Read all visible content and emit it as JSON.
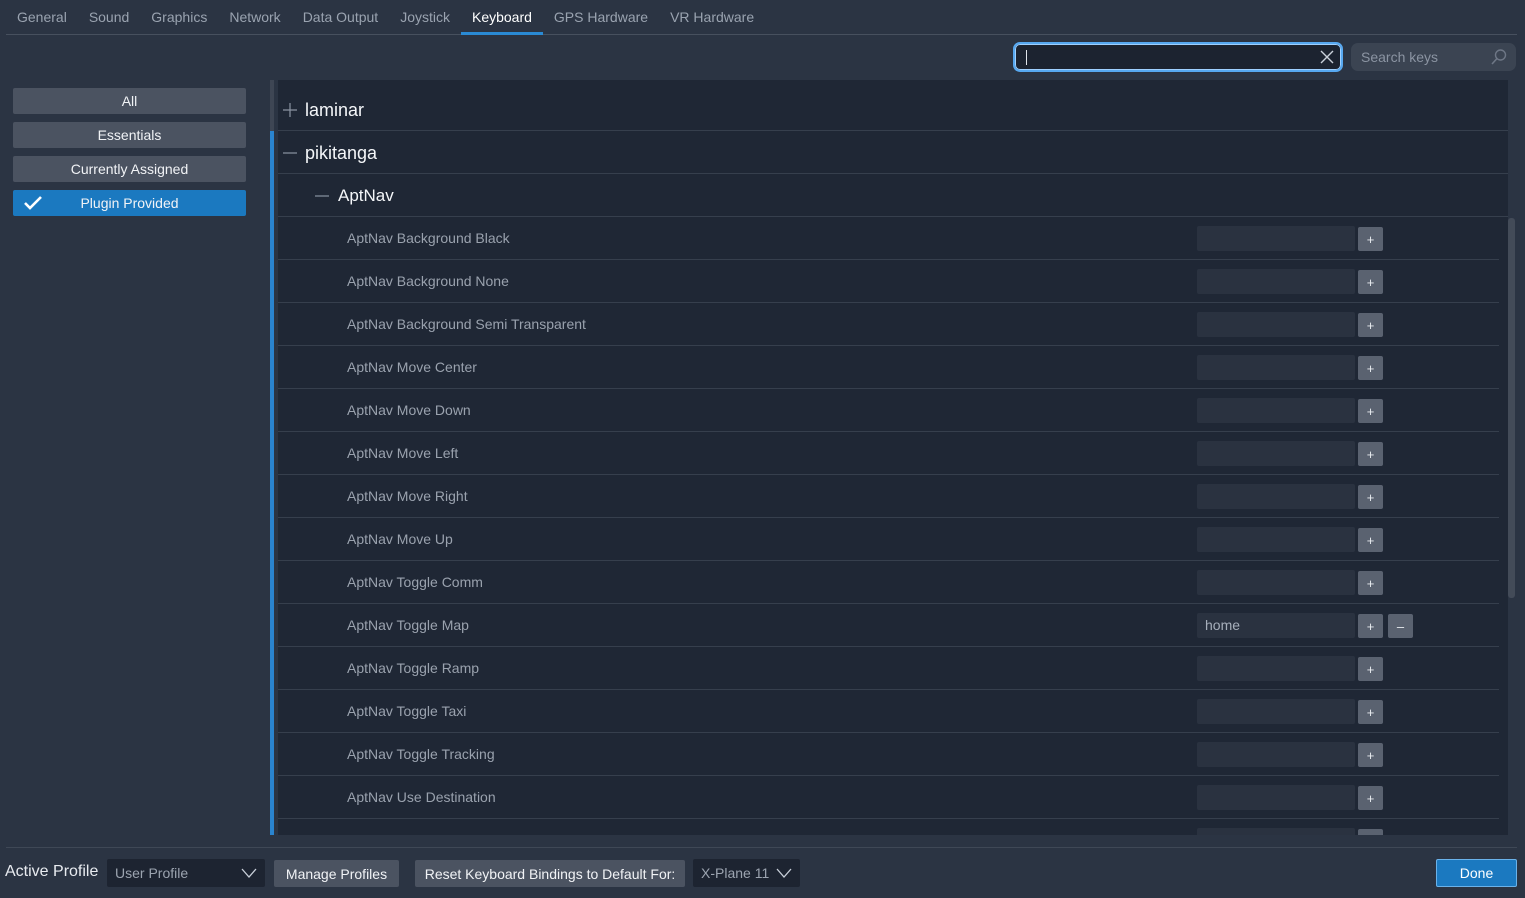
{
  "tabs": [
    {
      "label": "General",
      "active": false
    },
    {
      "label": "Sound",
      "active": false
    },
    {
      "label": "Graphics",
      "active": false
    },
    {
      "label": "Network",
      "active": false
    },
    {
      "label": "Data Output",
      "active": false
    },
    {
      "label": "Joystick",
      "active": false
    },
    {
      "label": "Keyboard",
      "active": true
    },
    {
      "label": "GPS Hardware",
      "active": false
    },
    {
      "label": "VR Hardware",
      "active": false
    }
  ],
  "search": {
    "value": "",
    "keys_placeholder": "Search keys"
  },
  "filters": [
    {
      "label": "All",
      "active": false
    },
    {
      "label": "Essentials",
      "active": false
    },
    {
      "label": "Currently Assigned",
      "active": false
    },
    {
      "label": "Plugin Provided",
      "active": true
    }
  ],
  "groups": {
    "laminar": {
      "label": "laminar",
      "expanded": false
    },
    "pikitanga": {
      "label": "pikitanga",
      "expanded": true
    },
    "aptnav": {
      "label": "AptNav",
      "expanded": true
    }
  },
  "commands": [
    {
      "label": "AptNav Background Black",
      "key": "",
      "add": "+",
      "remove": ""
    },
    {
      "label": "AptNav Background None",
      "key": "",
      "add": "+",
      "remove": ""
    },
    {
      "label": "AptNav Background Semi Transparent",
      "key": "",
      "add": "+",
      "remove": ""
    },
    {
      "label": "AptNav Move Center",
      "key": "",
      "add": "+",
      "remove": ""
    },
    {
      "label": "AptNav Move Down",
      "key": "",
      "add": "+",
      "remove": ""
    },
    {
      "label": "AptNav Move Left",
      "key": "",
      "add": "+",
      "remove": ""
    },
    {
      "label": "AptNav Move Right",
      "key": "",
      "add": "+",
      "remove": ""
    },
    {
      "label": "AptNav Move Up",
      "key": "",
      "add": "+",
      "remove": ""
    },
    {
      "label": "AptNav Toggle Comm",
      "key": "",
      "add": "+",
      "remove": ""
    },
    {
      "label": "AptNav Toggle Map",
      "key": "home",
      "add": "+",
      "remove": "–"
    },
    {
      "label": "AptNav Toggle Ramp",
      "key": "",
      "add": "+",
      "remove": ""
    },
    {
      "label": "AptNav Toggle Taxi",
      "key": "",
      "add": "+",
      "remove": ""
    },
    {
      "label": "AptNav Toggle Tracking",
      "key": "",
      "add": "+",
      "remove": ""
    },
    {
      "label": "AptNav Use Destination",
      "key": "",
      "add": "+",
      "remove": ""
    }
  ],
  "footer": {
    "active_profile_label": "Active Profile",
    "profile_value": "User Profile",
    "manage_profiles": "Manage Profiles",
    "reset_label": "Reset Keyboard Bindings to Default For:",
    "reset_target": "X-Plane 11",
    "done": "Done"
  },
  "colors": {
    "accent": "#1b79c0",
    "background": "#2b3443",
    "list_bg": "#1f2735"
  }
}
